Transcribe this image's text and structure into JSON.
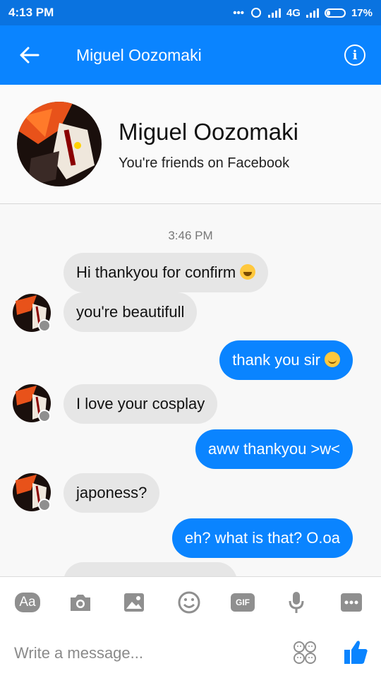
{
  "status_bar": {
    "time": "4:13 PM",
    "network": "4G",
    "battery": "17%"
  },
  "app_bar": {
    "title": "Miguel Oozomaki"
  },
  "profile": {
    "name": "Miguel Oozomaki",
    "subtitle": "You're friends on Facebook"
  },
  "conversation": {
    "timestamp": "3:46 PM",
    "messages": [
      {
        "from": "them",
        "text": "Hi thankyou for confirm",
        "emoji": "grin"
      },
      {
        "from": "them",
        "text": "you're beautifull"
      },
      {
        "from": "me",
        "text": "thank you sir",
        "emoji": "smile"
      },
      {
        "from": "them",
        "text": "I love your cosplay"
      },
      {
        "from": "me",
        "text": "aww thankyou >w<"
      },
      {
        "from": "them",
        "text": "japoness?"
      },
      {
        "from": "me",
        "text": "eh? what is that? O.oa"
      }
    ]
  },
  "toolbar": {
    "text_label": "Aa",
    "gif_label": "GIF",
    "icons": [
      "camera-icon",
      "gallery-icon",
      "emoji-icon",
      "mic-icon",
      "more-icon"
    ]
  },
  "composer": {
    "placeholder": "Write a message..."
  },
  "colors": {
    "brand": "#0a84ff",
    "status_bar": "#0a73e0",
    "incoming_bubble": "#e6e6e6",
    "outgoing_bubble": "#0a84ff"
  }
}
